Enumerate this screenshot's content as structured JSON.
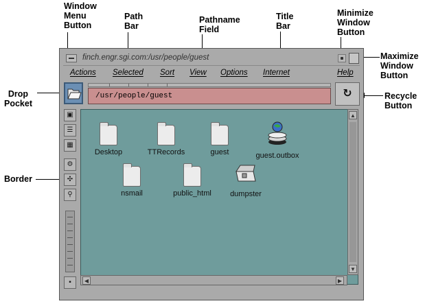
{
  "callouts": {
    "window_menu_button": "Window\nMenu\nButton",
    "path_bar": "Path\nBar",
    "pathname_field": "Pathname\nField",
    "title_bar": "Title\nBar",
    "minimize_window_button": "Minimize\nWindow\nButton",
    "maximize_window_button": "Maximize\nWindow\nButton",
    "drop_pocket": "Drop\nPocket",
    "recycle_button": "Recycle\nButton",
    "border": "Border"
  },
  "window": {
    "title": "finch.engr.sgi.com:/usr/people/guest",
    "path": "/usr/people/guest",
    "recycle_glyph": "↻"
  },
  "menu": {
    "actions": "Actions",
    "selected": "Selected",
    "sort": "Sort",
    "view": "View",
    "options": "Options",
    "internet": "Internet",
    "help": "Help"
  },
  "icons": [
    {
      "label": "Desktop",
      "type": "folder-icon"
    },
    {
      "label": "TTRecords",
      "type": "folder-icon"
    },
    {
      "label": "guest",
      "type": "folder-icon"
    },
    {
      "label": "guest.outbox",
      "type": "outbox-icon"
    },
    {
      "label": "nsmail",
      "type": "folder-icon"
    },
    {
      "label": "public_html",
      "type": "folder-icon"
    },
    {
      "label": "dumpster",
      "type": "dumpster-icon"
    }
  ],
  "colors": {
    "window_bg": "#aaaaaa",
    "view_bg": "#6f9c9c",
    "path_field": "#c98f8f",
    "drop_pocket": "#6b8fb4"
  }
}
